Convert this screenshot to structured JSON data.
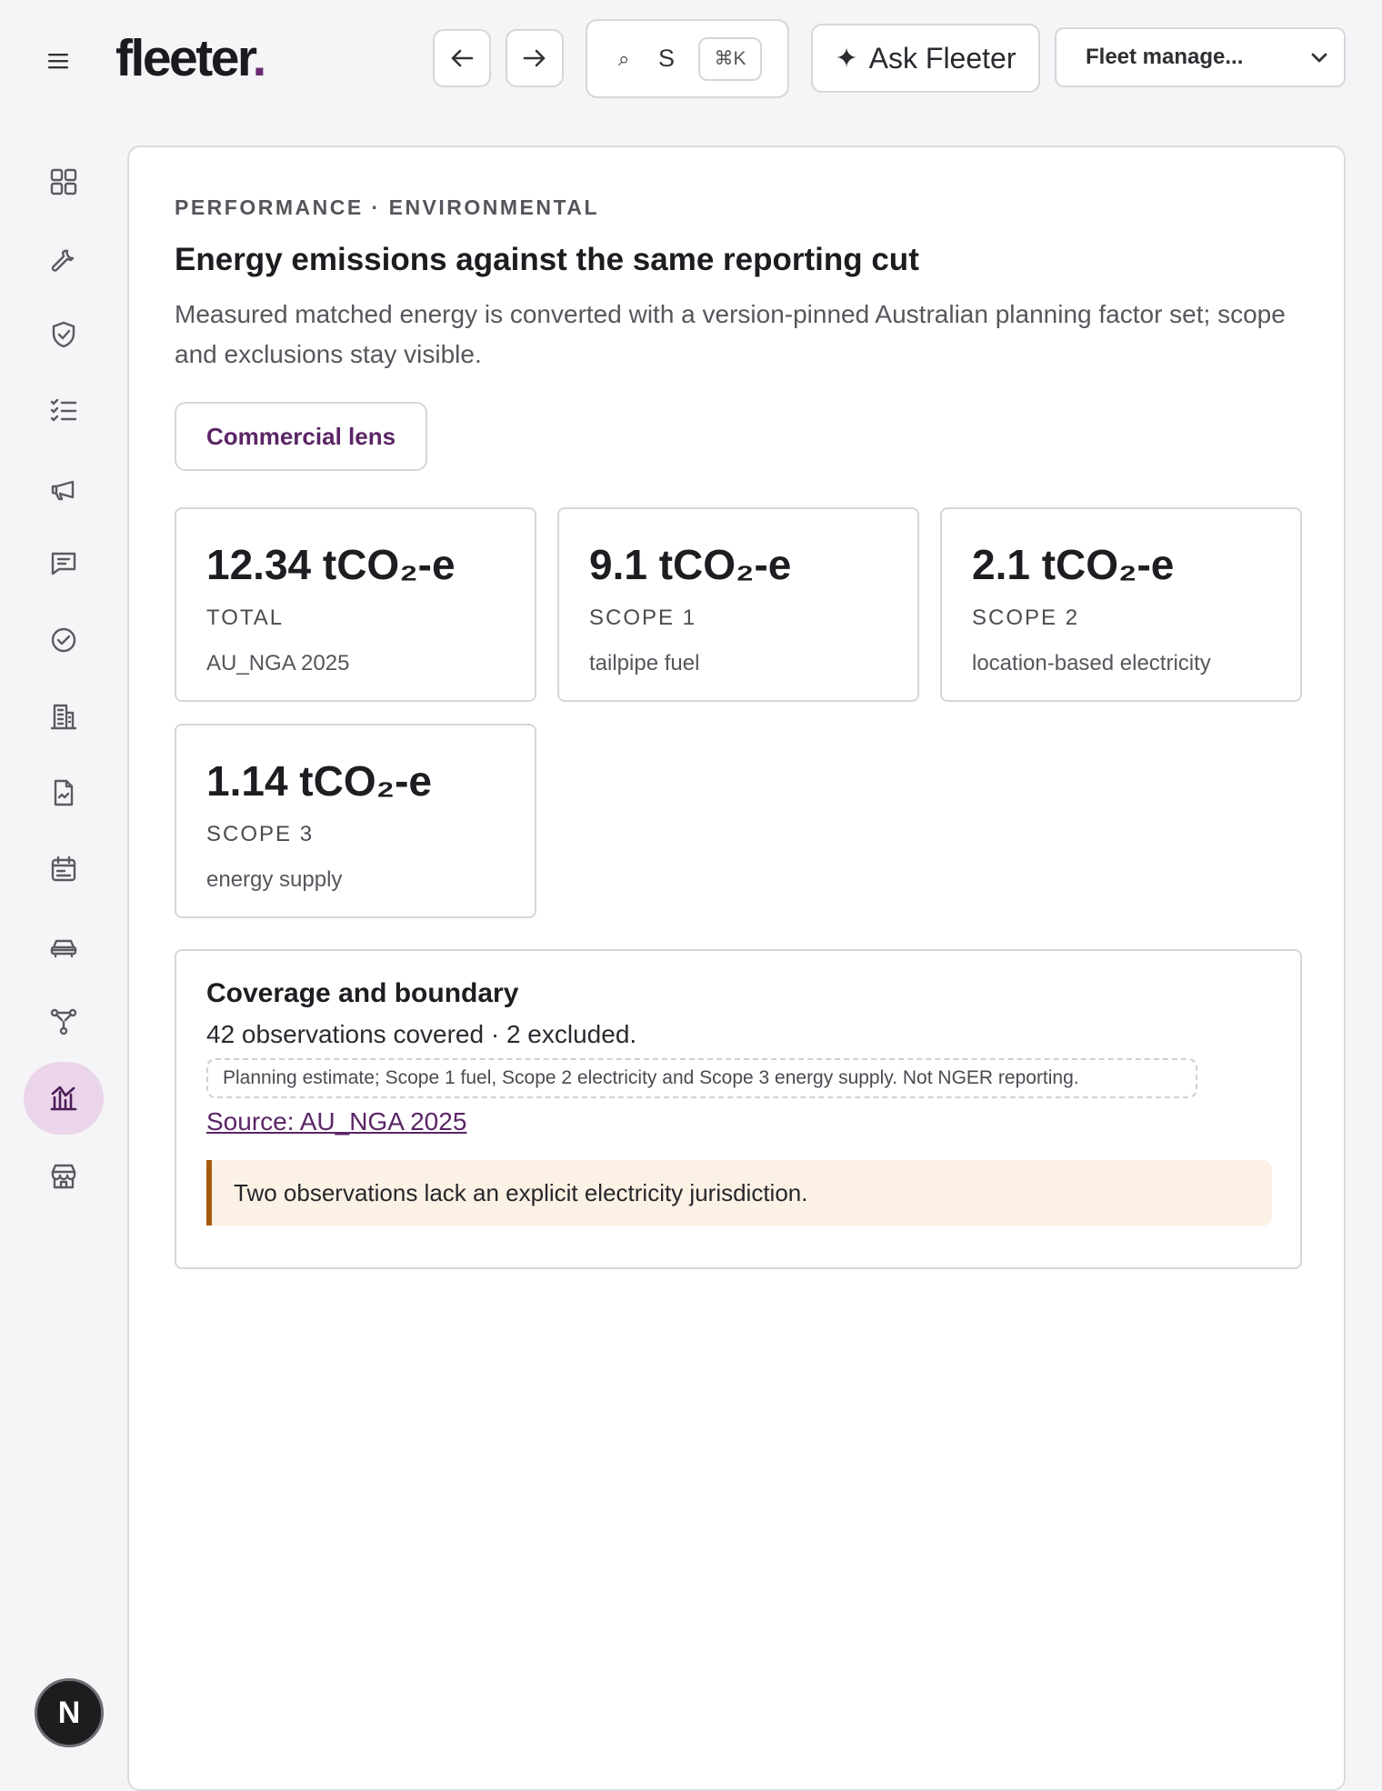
{
  "header": {
    "logo_text": "fleeter",
    "logo_dot": ".",
    "search": {
      "text": "S",
      "shortcut": "⌘K"
    },
    "ask_label": "Ask Fleeter",
    "fleet_select": "Fleet manage..."
  },
  "sidebar": {
    "items": [
      {
        "icon": "dashboard-grid-icon"
      },
      {
        "icon": "wrench-icon"
      },
      {
        "icon": "shield-check-icon"
      },
      {
        "icon": "checklist-icon"
      },
      {
        "icon": "megaphone-icon"
      },
      {
        "icon": "chat-icon"
      },
      {
        "icon": "check-circle-icon"
      },
      {
        "icon": "building-icon"
      },
      {
        "icon": "document-icon"
      },
      {
        "icon": "calendar-icon"
      },
      {
        "icon": "car-icon"
      },
      {
        "icon": "network-icon"
      },
      {
        "icon": "chart-icon",
        "active": true
      },
      {
        "icon": "store-icon"
      }
    ],
    "avatar": "N"
  },
  "main": {
    "eyebrow": "PERFORMANCE · ENVIRONMENTAL",
    "title": "Energy emissions against the same reporting cut",
    "subtitle": "Measured matched energy is converted with a version-pinned Australian planning factor set; scope and exclusions stay visible.",
    "lens_button": "Commercial lens",
    "metrics": [
      {
        "value": "12.34 tCO₂-e",
        "label": "TOTAL",
        "note": "AU_NGA 2025"
      },
      {
        "value": "9.1 tCO₂-e",
        "label": "SCOPE 1",
        "note": "tailpipe fuel"
      },
      {
        "value": "2.1 tCO₂-e",
        "label": "SCOPE 2",
        "note": "location-based electricity"
      },
      {
        "value": "1.14 tCO₂-e",
        "label": "SCOPE 3",
        "note": "energy supply"
      }
    ],
    "coverage": {
      "title": "Coverage and boundary",
      "count": "42 observations covered · 2 excluded.",
      "pill": "Planning estimate; Scope 1 fuel, Scope 2 electricity and Scope 3 energy supply. Not NGER reporting.",
      "source": "Source: AU_NGA 2025",
      "warning": "Two observations lack an explicit electricity jurisdiction."
    }
  },
  "colors": {
    "accent": "#6b2a72",
    "active_bg": "#ead5ea",
    "warning_bg": "#fbf1e4",
    "warning_border": "#a55a0e"
  }
}
